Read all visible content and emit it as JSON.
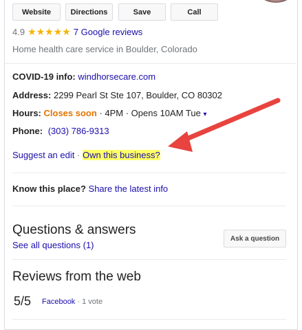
{
  "actions": {
    "website": "Website",
    "directions": "Directions",
    "save": "Save",
    "call": "Call"
  },
  "rating": {
    "score": "4.9",
    "stars": "★★★★★",
    "reviews_link": "7 Google reviews"
  },
  "category": "Home health care service in Boulder, Colorado",
  "info": {
    "covid_label": "COVID-19 info:",
    "covid_link": "windhorsecare.com",
    "address_label": "Address:",
    "address_value": "2299 Pearl St Ste 107, Boulder, CO 80302",
    "hours_label": "Hours:",
    "hours_status": "Closes soon",
    "hours_detail": "· 4PM · Opens 10AM Tue",
    "hours_caret": "▾",
    "phone_label": "Phone:",
    "phone_value": "(303) 786-9313",
    "suggest_edit": "Suggest an edit",
    "separator": "·",
    "own_business": "Own this business?"
  },
  "know_place": {
    "label": "Know this place?",
    "link": "Share the latest info"
  },
  "qa": {
    "title": "Questions & answers",
    "see_all": "See all questions (1)",
    "ask_button": "Ask a question"
  },
  "reviews_web": {
    "title": "Reviews from the web",
    "score": "5/5",
    "source": "Facebook",
    "votes": "· 1 vote"
  },
  "colors": {
    "link": "#1a0dab",
    "star": "#f4b400",
    "closes_soon": "#e37400",
    "highlight": "#ffff66",
    "arrow": "#e8433f"
  }
}
